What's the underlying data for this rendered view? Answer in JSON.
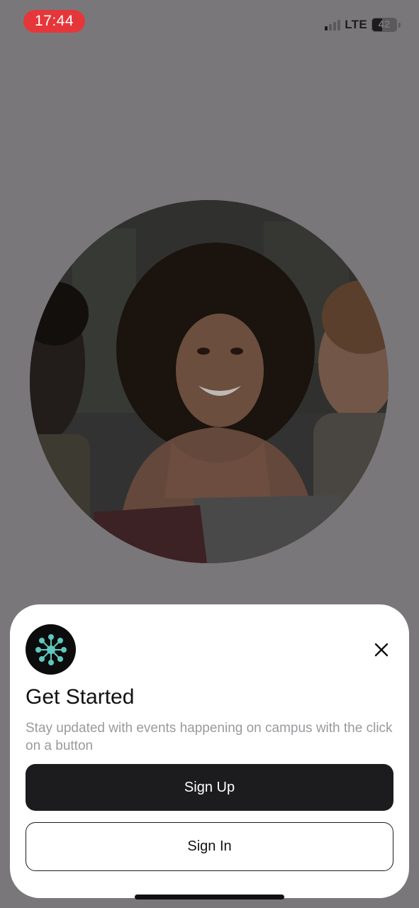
{
  "status_bar": {
    "time": "17:44",
    "network": "LTE",
    "battery_percent": "42",
    "battery_level": 0.42,
    "signal_bars_active": 1,
    "signal_bars_total": 4,
    "time_pill_color": "#e5373a"
  },
  "hero": {
    "image_icon": "students-photo"
  },
  "sheet": {
    "logo_icon": "network-hub-icon",
    "logo_accent_color": "#5ec8c0",
    "title": "Get Started",
    "subtitle": "Stay updated with events happening on campus with the click on a button",
    "primary_button": "Sign Up",
    "secondary_button": "Sign In",
    "close_icon": "close-icon"
  },
  "colors": {
    "backdrop": "#7a777b",
    "primary": "#1c1c1e",
    "sheet_bg": "#ffffff",
    "subtitle_text": "#9a9a9e"
  }
}
